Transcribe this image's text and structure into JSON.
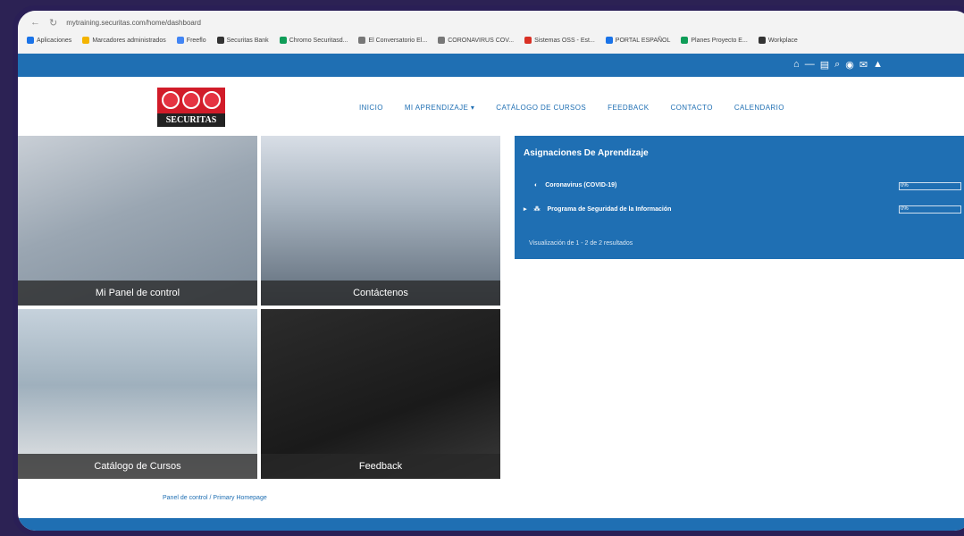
{
  "browser": {
    "url": "mytraining.securitas.com/home/dashboard",
    "bookmarks": [
      "Aplicaciones",
      "Marcadores administrados",
      "Freeflo",
      "Securitas Bank",
      "Chromo Securitasd...",
      "El Conversatorio El...",
      "CORONAVIRUS COV...",
      "Sistemas OSS - Est...",
      "PORTAL ESPAÑOL",
      "Planes Proyecto E...",
      "Workplace"
    ]
  },
  "logo": {
    "text": "SECURITAS"
  },
  "nav": {
    "items": [
      "INICIO",
      "MI APRENDIZAJE ▾",
      "CATÁLOGO DE CURSOS",
      "FEEDBACK",
      "CONTACTO",
      "CALENDARIO"
    ]
  },
  "tiles": [
    {
      "caption": "Mi Panel de control"
    },
    {
      "caption": "Contáctenos"
    },
    {
      "caption": "Catálogo de Cursos"
    },
    {
      "caption": "Feedback"
    }
  ],
  "panel": {
    "title": "Asignaciones De Aprendizaje",
    "rows": [
      {
        "label": "Coronavirus (COVID-19)",
        "pct": "0%"
      },
      {
        "label": "Programa de Seguridad de la Información",
        "pct": "0%"
      }
    ],
    "footer": "Visualización de 1 - 2 de 2 resultados"
  },
  "breadcrumb": "Panel de control / Primary Homepage",
  "colors": {
    "brand_blue": "#1f6fb3",
    "securitas_red": "#d11c29"
  }
}
